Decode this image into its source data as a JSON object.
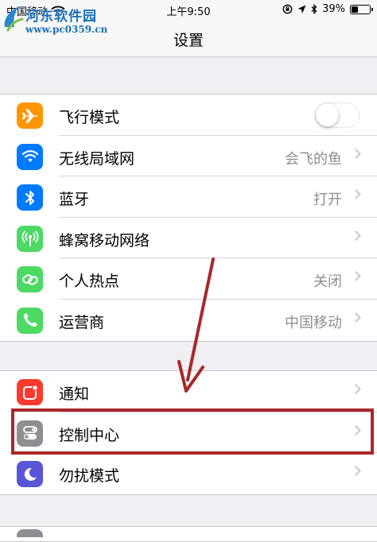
{
  "status_bar": {
    "carrier": "中国移动",
    "time": "上午9:50",
    "battery_percent": "39%",
    "battery_level": 0.39
  },
  "watermark": {
    "title": "河东软件园",
    "url": "www.pc0359.cn"
  },
  "nav": {
    "title": "设置"
  },
  "groups": [
    {
      "rows": [
        {
          "label": "飞行模式",
          "icon": "airplane-icon",
          "color": "#ff9500",
          "accessory": "toggle",
          "toggle_on": false
        },
        {
          "label": "无线局域网",
          "icon": "wifi-icon",
          "color": "#007aff",
          "value": "会飞的鱼",
          "accessory": "chevron"
        },
        {
          "label": "蓝牙",
          "icon": "bluetooth-icon",
          "color": "#007aff",
          "value": "打开",
          "accessory": "chevron"
        },
        {
          "label": "蜂窝移动网络",
          "icon": "cellular-icon",
          "color": "#4cd964",
          "accessory": "chevron"
        },
        {
          "label": "个人热点",
          "icon": "hotspot-icon",
          "color": "#4cd964",
          "value": "关闭",
          "accessory": "chevron"
        },
        {
          "label": "运营商",
          "icon": "phone-icon",
          "color": "#4cd964",
          "value": "中国移动",
          "accessory": "chevron"
        }
      ]
    },
    {
      "rows": [
        {
          "label": "通知",
          "icon": "notifications-icon",
          "color": "#ff3b30",
          "accessory": "chevron"
        },
        {
          "label": "控制中心",
          "icon": "control-center-icon",
          "color": "#8e8e93",
          "accessory": "chevron"
        },
        {
          "label": "勿扰模式",
          "icon": "moon-icon",
          "color": "#5856d6",
          "accessory": "chevron"
        }
      ]
    }
  ],
  "annotation": {
    "highlight_color": "#a8272a",
    "highlighted_item": "控制中心"
  }
}
